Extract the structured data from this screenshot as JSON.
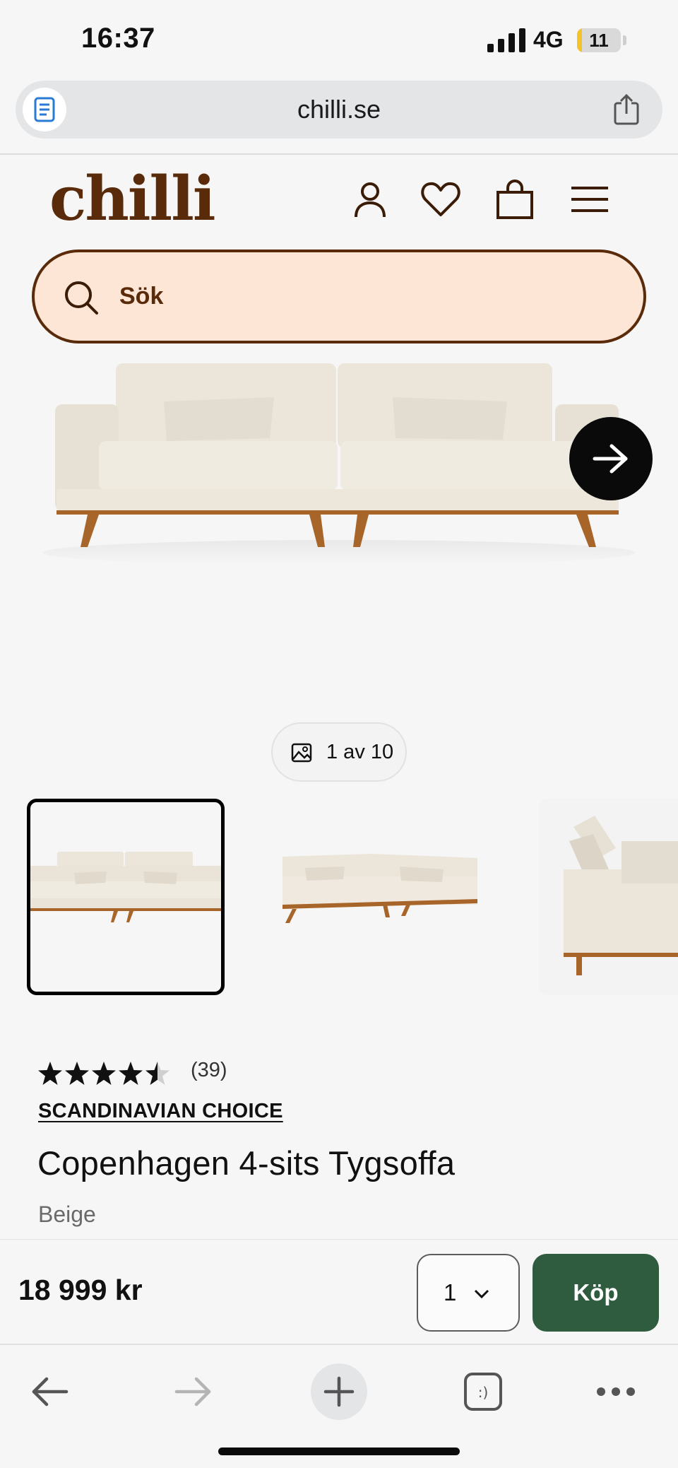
{
  "status_bar": {
    "time": "16:37",
    "network": "4G",
    "battery_level": 11,
    "battery_label": "11",
    "battery_color": "#f2c32b"
  },
  "browser": {
    "url": "chilli.se",
    "reader_icon": "document-icon",
    "share_icon": "share-icon"
  },
  "site_header": {
    "logo": "chilli",
    "brand_color": "#5a2b0a",
    "icons": [
      "account-icon",
      "heart-icon",
      "bag-icon",
      "menu-icon"
    ]
  },
  "search": {
    "label": "Sök",
    "background": "#fde6d6"
  },
  "gallery": {
    "counter": "1 av 10",
    "current_image": 1,
    "total_images": 10,
    "next_icon": "arrow-right-icon"
  },
  "product": {
    "rating": 4.5,
    "rating_max": 5,
    "review_count": "(39)",
    "brand": "SCANDINAVIAN CHOICE",
    "title": "Copenhagen 4-sits Tygsoffa",
    "color": "Beige"
  },
  "buy_bar": {
    "price": "18 999 kr",
    "quantity": "1",
    "buy_label": "Köp",
    "buy_color": "#2f5b3f"
  },
  "toolbar": {
    "icons": [
      "back-arrow-icon",
      "forward-arrow-icon",
      "plus-icon",
      "tabs-icon",
      "more-icon"
    ],
    "tabs_glyph": ":)"
  }
}
